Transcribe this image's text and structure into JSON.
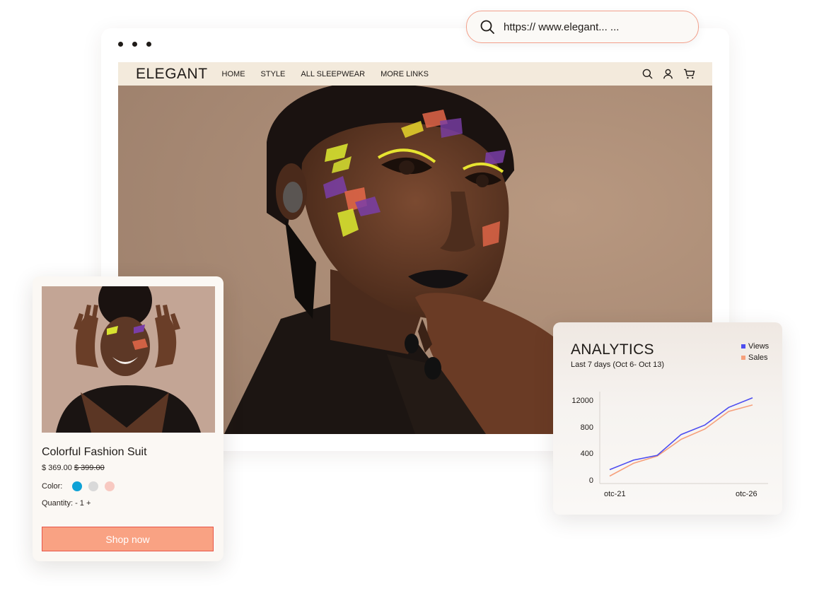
{
  "url_bar": {
    "url": "https:// www.elegant... ..."
  },
  "site": {
    "logo": "ELEGANT",
    "nav": [
      "HOME",
      "STYLE",
      "ALL SLEEPWEAR",
      "MORE LINKS"
    ]
  },
  "product": {
    "title": "Colorful Fashion Suit",
    "price": "$ 369.00",
    "old_price": "$ 399.00",
    "color_label": "Color:",
    "colors": [
      "#0ea2d6",
      "#d9d9d9",
      "#f8c9c1"
    ],
    "quantity": "Quantity: - 1 +",
    "button": "Shop now"
  },
  "analytics": {
    "title": "ANALYTICS",
    "subtitle": "Last 7 days (Oct 6- Oct 13)",
    "legend": [
      {
        "name": "Views",
        "color": "#4d4df0"
      },
      {
        "name": "Sales",
        "color": "#f6a07c"
      }
    ]
  },
  "chart_data": {
    "type": "line",
    "y_ticks": [
      "12000",
      "800",
      "400",
      "0"
    ],
    "x_ticks": [
      "otc-21",
      "otc-26"
    ],
    "series": [
      {
        "name": "Views",
        "values": [
          60,
          120,
          150,
          280,
          340,
          450,
          510
        ]
      },
      {
        "name": "Sales",
        "values": [
          20,
          100,
          145,
          250,
          315,
          425,
          465
        ]
      }
    ]
  }
}
